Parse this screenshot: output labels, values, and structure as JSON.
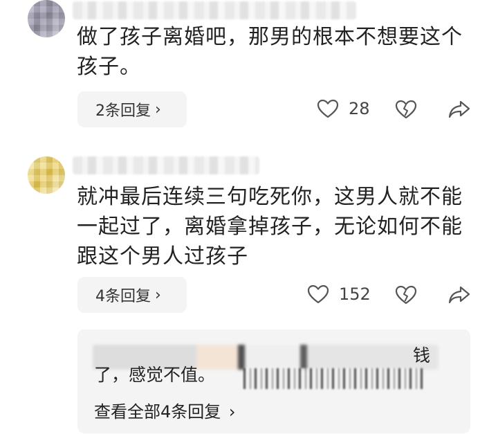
{
  "comments": [
    {
      "text": "做了孩子离婚吧，那男的根本不想要这个孩子。",
      "replies_label": "2条回复",
      "likes": "28",
      "icons": [
        "heart-outline-icon",
        "broken-heart-icon",
        "share-arrow-icon"
      ]
    },
    {
      "text": "就冲最后连续三句吃死你，这男人就不能一起过了，离婚拿掉孩子，无论如何不能跟这个男人过孩子",
      "replies_label": "4条回复",
      "likes": "152",
      "icons": [
        "heart-outline-icon",
        "broken-heart-icon",
        "share-arrow-icon"
      ],
      "sub_reply_preview": {
        "visible_text": "了，感觉不值。",
        "visible_fragment_top": "钱",
        "view_all_label": "查看全部4条回复"
      }
    }
  ],
  "chevron": "›",
  "colors": {
    "icon_stroke": "#555555",
    "pill_bg": "#f4f4f4",
    "text": "#222222"
  }
}
